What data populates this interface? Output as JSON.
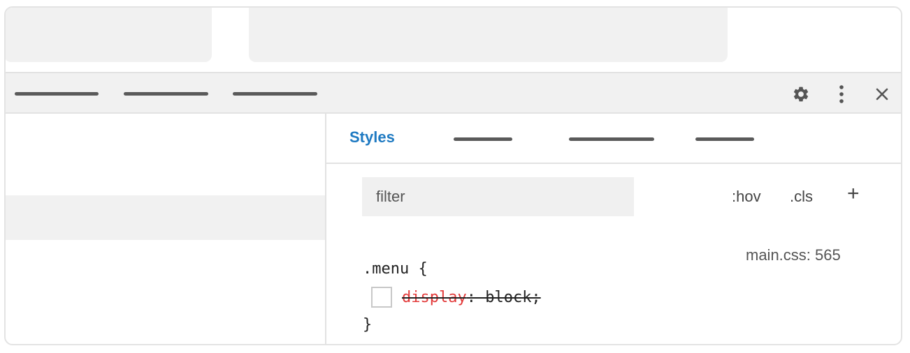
{
  "styles_panel": {
    "active_tab": "Styles",
    "filter_placeholder": "filter",
    "hov_label": ":hov",
    "cls_label": ".cls",
    "add_rule_symbol": "+",
    "rule": {
      "source": "main.css: 565",
      "selector_line": ".menu {",
      "property": "display",
      "value_part": ": block;",
      "closing_brace": "}",
      "declaration_checked": false,
      "declaration_overridden": true
    }
  },
  "toolbar": {
    "icons": [
      "gear-icon",
      "more-vert-icon",
      "close-icon"
    ]
  },
  "colors": {
    "accent": "#1f7ac2",
    "property_red": "#e23a3a",
    "panel_gray": "#f1f1f1"
  }
}
